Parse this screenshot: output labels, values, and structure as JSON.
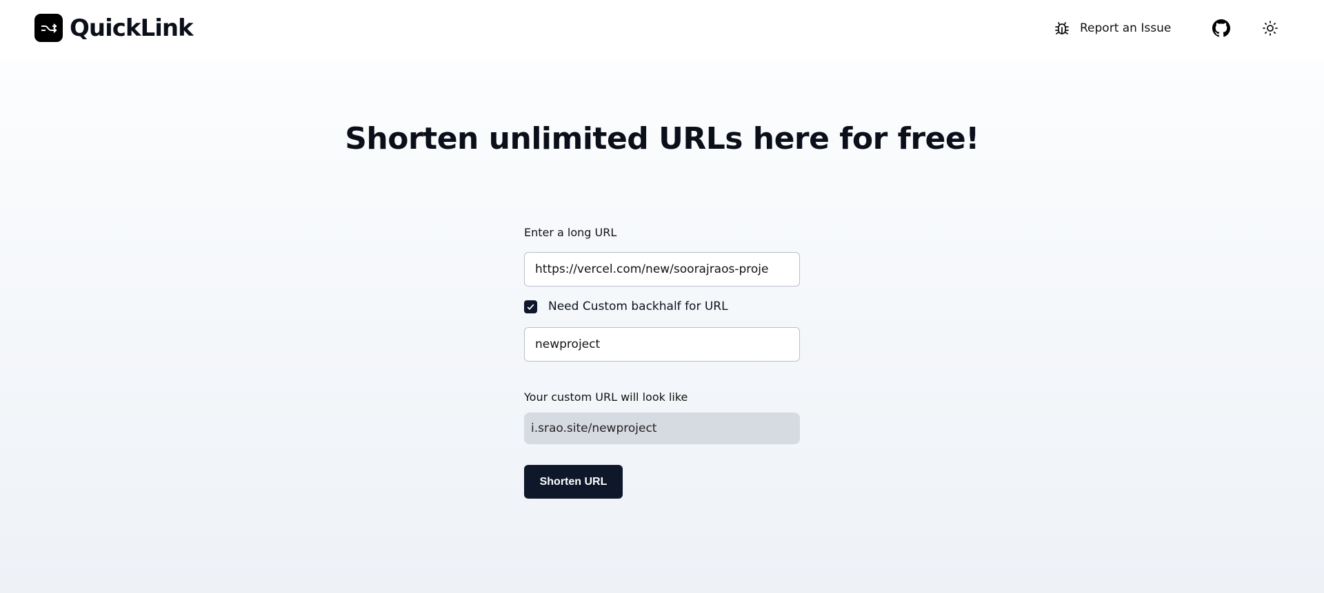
{
  "header": {
    "brand": "QuickLink",
    "report_label": "Report an Issue",
    "icons": [
      "bug-icon",
      "github-icon",
      "sun-icon"
    ]
  },
  "main": {
    "title": "Shorten unlimited URLs here for free!",
    "long_url_label": "Enter a long URL",
    "long_url_value": "https://vercel.com/new/soorajraos-proje",
    "custom_checkbox_label": "Need Custom backhalf for URL",
    "custom_checked": true,
    "backhalf_value": "newproject",
    "preview_label": "Your custom URL will look like",
    "preview_value": "i.srao.site/newproject",
    "submit_label": "Shorten URL"
  },
  "colors": {
    "primary": "#0f172a",
    "preview_bg": "#d6dae1"
  }
}
